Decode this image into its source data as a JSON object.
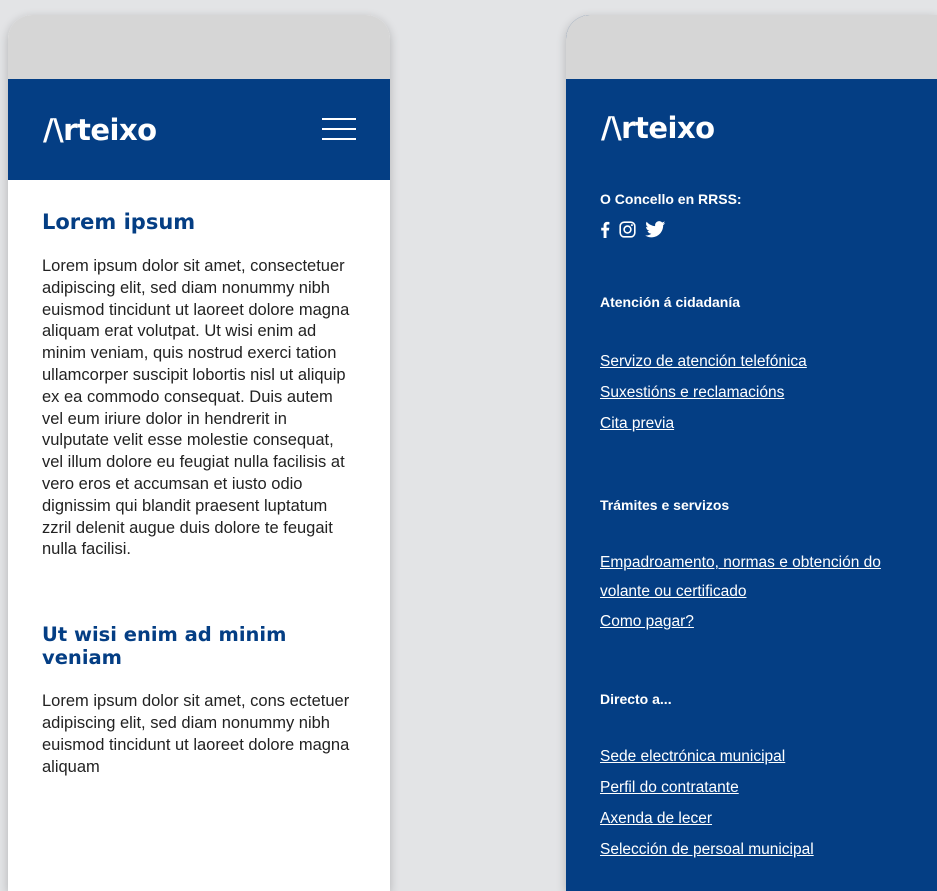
{
  "left_screen": {
    "logo": "/\\rteixo",
    "sections": [
      {
        "heading": "Lorem ipsum",
        "text": "Lorem ipsum dolor sit amet, consectetuer adipiscing elit, sed diam nonummy nibh euismod tincidunt ut laoreet dolore magna aliquam erat volutpat. Ut wisi enim ad minim veniam, quis nostrud exerci tation ullamcorper suscipit lobortis nisl ut aliquip ex ea commodo consequat. Duis autem vel eum iriure dolor in hendrerit in vulputate velit esse molestie consequat, vel illum dolore eu feugiat nulla facilisis at vero eros et accumsan et iusto odio dignissim qui blandit praesent luptatum zzril delenit augue duis dolore te feugait nulla facilisi."
      },
      {
        "heading": "Ut wisi enim ad minim veniam",
        "text": "Lorem ipsum dolor sit amet, cons ectetuer adipiscing elit, sed diam nonummy nibh euismod tincidunt ut laoreet dolore magna aliquam"
      }
    ]
  },
  "right_screen": {
    "logo": "/\\rteixo",
    "social_label": "O Concello en RRSS:",
    "social_icons": [
      "facebook-icon",
      "instagram-icon",
      "twitter-icon"
    ],
    "groups": [
      {
        "title": "Atención á cidadanía",
        "links": [
          "Servizo de atención telefónica",
          "Suxestións e reclamacións",
          "Cita previa"
        ]
      },
      {
        "title": "Trámites e servizos",
        "links": [
          "Empadroamento, normas e obtención do volante ou certificado",
          "Como pagar?"
        ]
      },
      {
        "title": "Directo a...",
        "links": [
          "Sede electrónica municipal",
          "Perfil do contratante",
          "Axenda de lecer",
          "Selección de persoal municipal"
        ]
      }
    ]
  },
  "colors": {
    "brand_blue": "#043e84",
    "status_bar": "#d6d6d6",
    "background": "#e3e4e6"
  }
}
